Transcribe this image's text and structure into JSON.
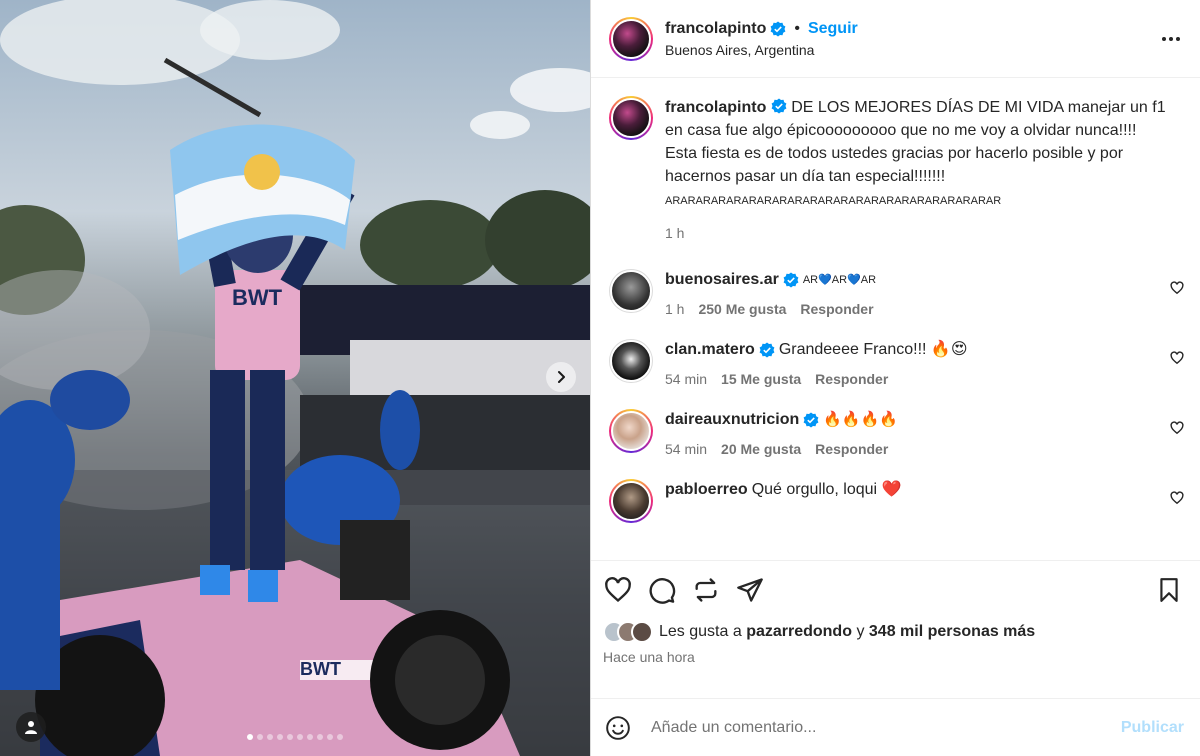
{
  "post": {
    "username": "francolapinto",
    "follow_label": "Seguir",
    "separator": "•",
    "location": "Buenos Aires, Argentina",
    "more_icon": "more-horizontal-icon"
  },
  "media": {
    "slide_count": 10,
    "active_slide": 0,
    "car_text": "BWT",
    "suit_text": "BWT"
  },
  "caption": {
    "username": "francolapinto",
    "text_main": "DE LOS MEJORES DÍAS DE MI VIDA manejar un f1 en casa fue algo épicooooooooo que no me voy a olvidar nunca!!!!",
    "text_second": "Esta fiesta es de todos ustedes gracias por hacerlo posible y por hacernos pasar un día tan especial!!!!!!!",
    "text_small": "ARARARARARARARARARARARARARARARARARARARARARAR",
    "time": "1 h"
  },
  "comments": [
    {
      "username": "buenosaires.ar",
      "verified": true,
      "text": "AR💙AR💙AR",
      "time": "1 h",
      "likes": "250 Me gusta",
      "reply": "Responder"
    },
    {
      "username": "clan.matero",
      "verified": true,
      "text": "Grandeeee Franco!!! 🔥😍",
      "time": "54 min",
      "likes": "15 Me gusta",
      "reply": "Responder"
    },
    {
      "username": "daireauxnutricion",
      "verified": true,
      "text": "🔥🔥🔥🔥",
      "time": "54 min",
      "likes": "20 Me gusta",
      "reply": "Responder"
    },
    {
      "username": "pabloerreo",
      "verified": false,
      "text": "Qué orgullo, loqui ❤️"
    }
  ],
  "likes": {
    "prefix": "Les gusta a",
    "user": "pazarredondo",
    "joiner": "y",
    "others": "348 mil personas más",
    "time_ago": "Hace una hora"
  },
  "add_comment": {
    "placeholder": "Añade un comentario...",
    "publish": "Publicar"
  },
  "colors": {
    "accent": "#0095f6",
    "publish_disabled": "#b2dffc",
    "muted": "#737373"
  }
}
